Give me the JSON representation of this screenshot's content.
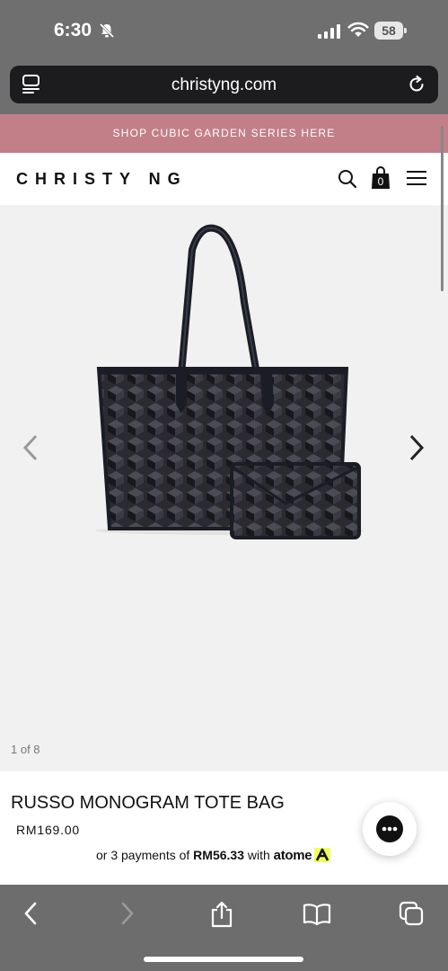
{
  "status_bar": {
    "time": "6:30",
    "battery_level": "58"
  },
  "browser": {
    "url": "christyng.com"
  },
  "promo_banner": {
    "text": "SHOP CUBIC GARDEN SERIES HERE"
  },
  "site": {
    "brand": "CHRISTY NG",
    "cart_count": "0"
  },
  "gallery": {
    "counter": "1 of 8"
  },
  "product": {
    "title": "RUSSO MONOGRAM TOTE BAG",
    "price": "RM169.00",
    "installment_prefix": "or 3 payments of ",
    "installment_amount": "RM56.33",
    "installment_with": " with ",
    "installment_provider": "atome"
  },
  "colors": {
    "promo": "#c27f87",
    "atome_accent": "#f0ff5f",
    "chrome": "#6d6d6d"
  }
}
